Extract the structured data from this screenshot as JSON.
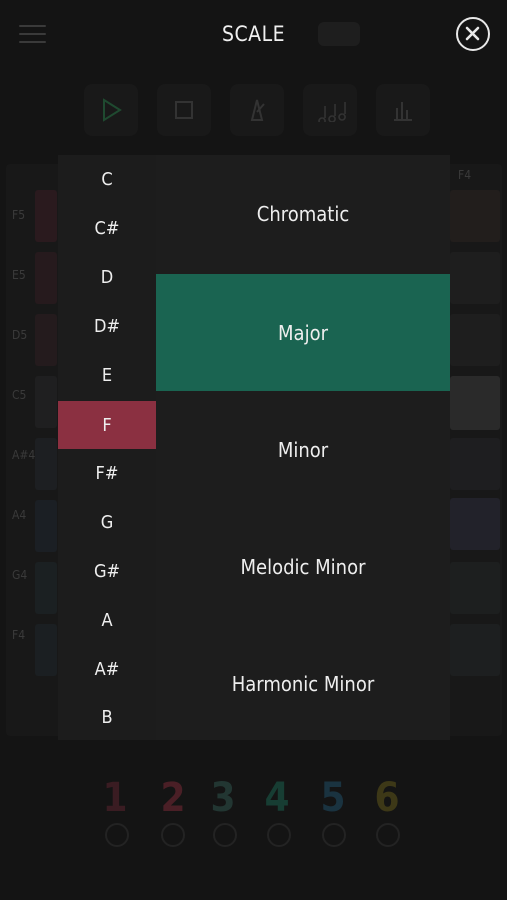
{
  "header": {
    "title": "SCALE",
    "menu_icon": "hamburger-menu-icon",
    "close_icon": "close-circle-icon"
  },
  "notes": {
    "items": [
      "C",
      "C#",
      "D",
      "D#",
      "E",
      "F",
      "F#",
      "G",
      "G#",
      "A",
      "A#",
      "B"
    ],
    "selected": "F",
    "selected_color": "#8b3041"
  },
  "scales": {
    "items": [
      "Chromatic",
      "Major",
      "Minor",
      "Melodic Minor",
      "Harmonic Minor"
    ],
    "selected": "Major",
    "selected_color": "#1a6451"
  },
  "background": {
    "toolbar_icons": [
      "play-icon",
      "stop-icon",
      "metronome-icon",
      "notes-icon",
      "bars-icon"
    ],
    "row_labels": [
      "F5",
      "E5",
      "D5",
      "C5",
      "A#4",
      "A4",
      "G4",
      "F4"
    ],
    "column_label": "F4",
    "channels": [
      "1",
      "2",
      "3",
      "4",
      "5",
      "6"
    ],
    "channel_colors": [
      "#5a2630",
      "#6b2a32",
      "#2e4a45",
      "#1f5a4a",
      "#234a5a",
      "#5a5220"
    ]
  }
}
